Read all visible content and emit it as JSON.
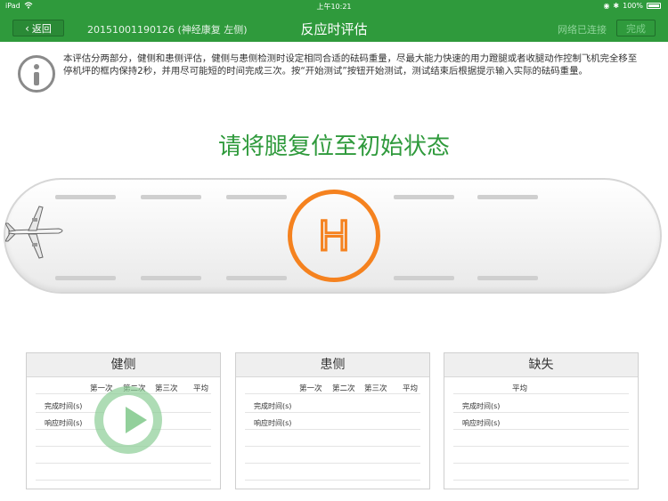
{
  "status_bar": {
    "carrier": "iPad",
    "time": "上午10:21",
    "battery": "100%"
  },
  "nav": {
    "back_label": "返回",
    "patient": "20151001190126 (神经康复 左侧)",
    "title": "反应时评估",
    "network_status": "网络已连接",
    "done_label": "完成"
  },
  "instructions": "本评估分两部分，健侧和患侧评估，健侧与患侧检测时设定相同合适的砝码重量，尽最大能力快速的用力蹬腿或者收腿动作控制飞机完全移至停机坪的框内保持2秒，并用尽可能短的时间完成三次。按“开始测试”按钮开始测试，测试结束后根据提示输入实际的砝码重量。",
  "prompt": "请将腿复位至初始状态",
  "heliport_letter": "H",
  "cards": [
    {
      "title": "健侧",
      "columns": [
        "第一次",
        "第二次",
        "第三次",
        "平均"
      ],
      "rows": [
        "完成时间(s)",
        "响应时间(s)"
      ]
    },
    {
      "title": "患侧",
      "columns": [
        "第一次",
        "第二次",
        "第三次",
        "平均"
      ],
      "rows": [
        "完成时间(s)",
        "响应时间(s)"
      ]
    },
    {
      "title": "缺失",
      "columns": [
        "平均"
      ],
      "rows": [
        "完成时间(s)",
        "响应时间(s)"
      ]
    }
  ],
  "colors": {
    "brand_green": "#2f9a3c",
    "heliport_orange": "#f5821f"
  }
}
